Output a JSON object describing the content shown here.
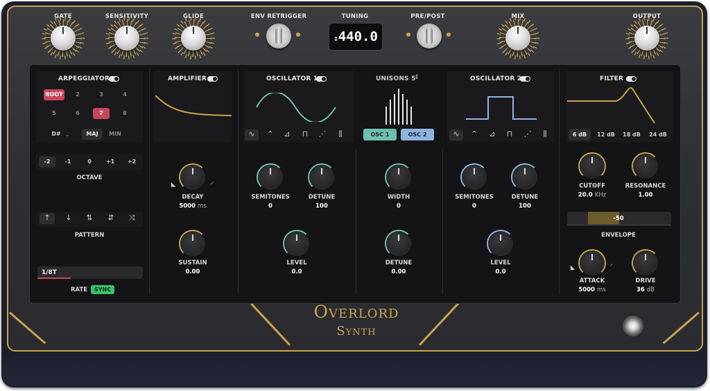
{
  "brand": {
    "line1": "Overlord",
    "line2": "Synth"
  },
  "top": {
    "gate": "GATE",
    "sensitivity": "SENSITIVITY",
    "glide": "GLIDE",
    "env_retrigger": "ENV RETRIGGER",
    "tuning": "TUNING",
    "tuning_value": "440.0",
    "pre_post": "PRE/POST",
    "mix": "MIX",
    "output": "OUTPUT"
  },
  "arp": {
    "title": "ARPEGGIATOR",
    "notes": [
      "ROOT",
      "2",
      "3",
      "4",
      "5",
      "6",
      "7",
      "8"
    ],
    "key": "D#",
    "major": "MAJ",
    "minor": "MIN",
    "octaves": [
      "-2",
      "-1",
      "0",
      "+1",
      "+2"
    ],
    "octave_label": "OCTAVE",
    "pattern_icons": [
      "↑",
      "↓",
      "⇅",
      "⇵",
      "⤨"
    ],
    "pattern_label": "PATTERN",
    "rate_value": "1/8T",
    "rate_label": "RATE",
    "sync": "SYNC"
  },
  "amp": {
    "title": "AMPLIFIER",
    "decay_label": "DECAY",
    "decay_value": "5000",
    "decay_unit": "ms",
    "sustain_label": "SUSTAIN",
    "sustain_value": "0.00"
  },
  "osc1": {
    "title": "OSCILLATOR 1",
    "semitones_label": "SEMITONES",
    "semitones_value": "0",
    "detune_label": "DETUNE",
    "detune_value": "100",
    "level_label": "LEVEL",
    "level_value": "0.0"
  },
  "unison": {
    "title": "UNISONS 5",
    "osc1_btn": "OSC 1",
    "osc2_btn": "OSC 2",
    "width_label": "WIDTH",
    "width_value": "0",
    "detune_label": "DETUNE",
    "detune_value": "0.00"
  },
  "osc2": {
    "title": "OSCILLATOR 2",
    "semitones_label": "SEMITONES",
    "semitones_value": "0",
    "detune_label": "DETUNE",
    "detune_value": "100",
    "level_label": "LEVEL",
    "level_value": "0.0"
  },
  "filter": {
    "title": "FILTER",
    "slopes": [
      "6 dB",
      "12 dB",
      "18 dB",
      "24 dB"
    ],
    "cutoff_label": "CUTOFF",
    "cutoff_value": "20.0",
    "cutoff_unit": "KHz",
    "resonance_label": "RESONANCE",
    "resonance_value": "1.00",
    "env_value": "-50",
    "envelope_label": "ENVELOPE",
    "attack_label": "ATTACK",
    "attack_value": "5000",
    "attack_unit": "ms",
    "drive_label": "DRIVE",
    "drive_value": "36",
    "drive_unit": "dB"
  },
  "colors": {
    "gold": "#c9a44d",
    "teal": "#6fbfb0",
    "blue": "#8fb4e0",
    "red": "#c9465a",
    "green": "#39c26a"
  }
}
